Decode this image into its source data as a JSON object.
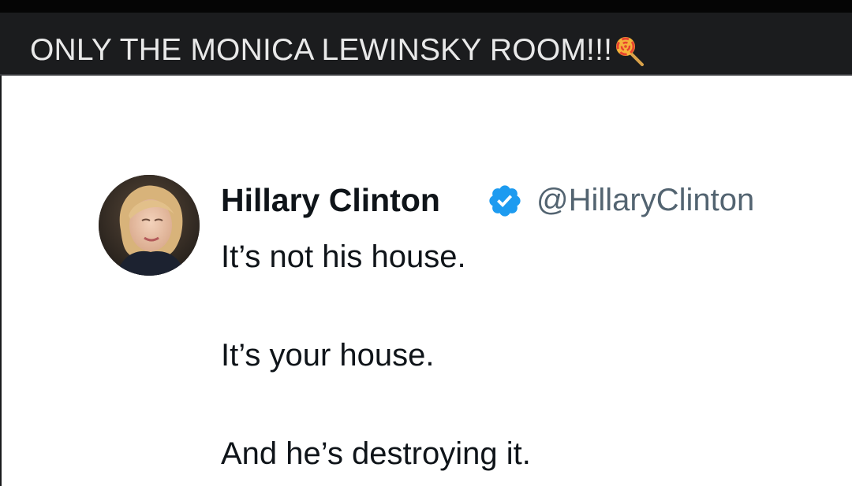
{
  "caption": {
    "text": "ONLY THE MONICA LEWINSKY ROOM!!!",
    "emoji_icon": "lollipop-icon"
  },
  "tweet": {
    "author_name": "Hillary Clinton",
    "verified_icon": "verified-badge-icon",
    "handle": "@HillaryClinton",
    "lines": [
      "It’s not his house.",
      "It’s your house.",
      "And he’s destroying it."
    ]
  },
  "colors": {
    "caption_bg": "#1b1c1e",
    "caption_text": "#e9e9e9",
    "verified_blue": "#1d9bf0",
    "handle_gray": "#536471",
    "text_dark": "#0f1419"
  }
}
